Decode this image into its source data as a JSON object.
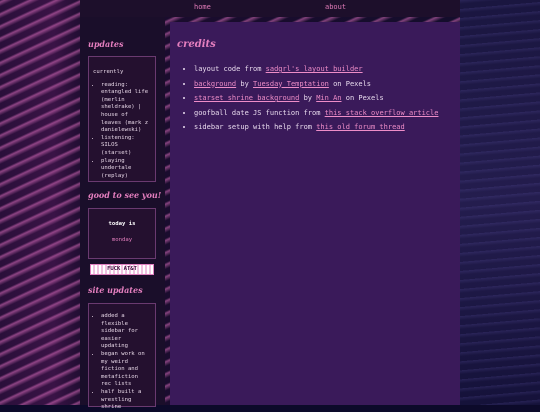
{
  "nav": {
    "home": "home",
    "about": "about"
  },
  "sidebar": {
    "updates_heading": "updates",
    "currently_label": "currently",
    "currently": [
      "reading: entangled life (merlin sheldrake) | house of leaves (mark z danielewski)",
      "listening: SILOS (starset)",
      "playing undertale (replay)"
    ],
    "greeting_heading": "good to see you!",
    "today_label": "today is",
    "today_value": "monday",
    "button_text": "FUCK AT&T",
    "site_updates_heading": "site updates",
    "site_updates": [
      "added a flexible sidebar for easier updating",
      "began work on my weird fiction and metafiction rec lists",
      "half built a wrestling shrine"
    ]
  },
  "main": {
    "title": "credits",
    "credits": [
      {
        "pre": "layout code from ",
        "link": "sadgrl's layout builder",
        "post": ""
      },
      {
        "pre": "",
        "link": "background",
        "mid": " by ",
        "link2": "Tuesday Temptation",
        "post": " on Pexels"
      },
      {
        "pre": "",
        "link": "starset shrine background",
        "mid": " by ",
        "link2": "Min An",
        "post": " on Pexels"
      },
      {
        "pre": "goofball date JS function from ",
        "link": "this stack overflow article",
        "post": ""
      },
      {
        "pre": "sidebar setup with help from ",
        "link": "this old forum thread",
        "post": ""
      }
    ]
  },
  "colors": {
    "accent": "#e57fbf",
    "main_bg": "#3a1a5a",
    "sidebar_bg": "#1a0e2a"
  }
}
